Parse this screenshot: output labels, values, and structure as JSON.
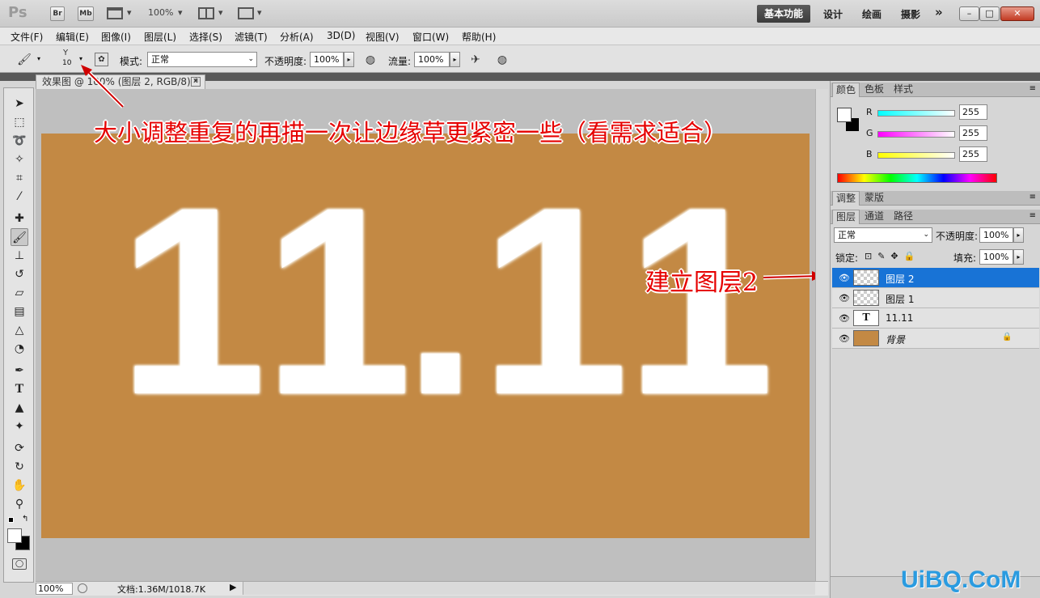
{
  "titlebar": {
    "app_logo": "Ps",
    "bridge": "Br",
    "minibridge": "Mb",
    "zoom": "100%",
    "workspaces": [
      "基本功能",
      "设计",
      "绘画",
      "摄影"
    ],
    "more": "»"
  },
  "menu": [
    "文件(F)",
    "编辑(E)",
    "图像(I)",
    "图层(L)",
    "选择(S)",
    "滤镜(T)",
    "分析(A)",
    "3D(D)",
    "视图(V)",
    "窗口(W)",
    "帮助(H)"
  ],
  "options": {
    "brush_size": "10",
    "mode_label": "模式:",
    "mode_value": "正常",
    "opacity_label": "不透明度:",
    "opacity_value": "100%",
    "flow_label": "流量:",
    "flow_value": "100%"
  },
  "document": {
    "tab_title": "效果图 @ 100% (图层 2, RGB/8) *",
    "canvas_color": "#c38944",
    "canvas_text_digits": [
      "1",
      "1",
      ".",
      "1",
      "1"
    ]
  },
  "annotations": {
    "top": "大小调整重复的再描一次让边缘草更紧密一些（看需求适合）",
    "right": "建立图层2"
  },
  "statusbar": {
    "zoom": "100%",
    "doc_info": "文档:1.36M/1018.7K"
  },
  "color_panel": {
    "tabs": [
      "颜色",
      "色板",
      "样式"
    ],
    "channels": [
      {
        "label": "R",
        "value": "255"
      },
      {
        "label": "G",
        "value": "255"
      },
      {
        "label": "B",
        "value": "255"
      }
    ]
  },
  "adjust_panel": {
    "tabs": [
      "调整",
      "蒙版"
    ]
  },
  "layers_panel": {
    "tabs": [
      "图层",
      "通道",
      "路径"
    ],
    "blend_mode": "正常",
    "opacity_label": "不透明度:",
    "opacity_value": "100%",
    "lock_label": "锁定:",
    "fill_label": "填充:",
    "fill_value": "100%",
    "layers": [
      {
        "name": "图层 2",
        "selected": true
      },
      {
        "name": "图层 1",
        "selected": false
      },
      {
        "name": "11.11",
        "selected": false
      },
      {
        "name": "背景",
        "selected": false
      }
    ]
  },
  "watermark": "UiBQ.CoM",
  "colors": {
    "accent": "#1873d6",
    "annotation": "#e60000",
    "canvas": "#c38944"
  }
}
